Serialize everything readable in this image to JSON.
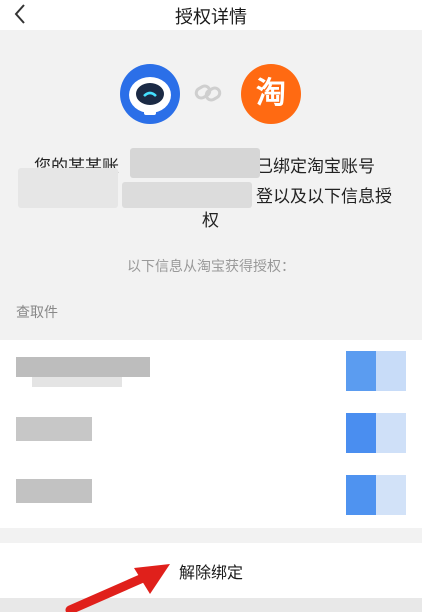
{
  "nav": {
    "title": "授权详情"
  },
  "desc": {
    "line1_left": "您的某某账",
    "line1_right": "已绑定淘宝账号",
    "line2_right": "登以及以下信息授",
    "line3": "权"
  },
  "tb_icon_text": "淘",
  "info_note": "以下信息从淘宝获得授权：",
  "permissions_title": "查取件",
  "footer": {
    "unbind_label": "解除绑定"
  },
  "colors": {
    "accent_blue": "#2b6fe8",
    "taobao_orange": "#ff6a12",
    "annotation_red": "#e0201b"
  }
}
